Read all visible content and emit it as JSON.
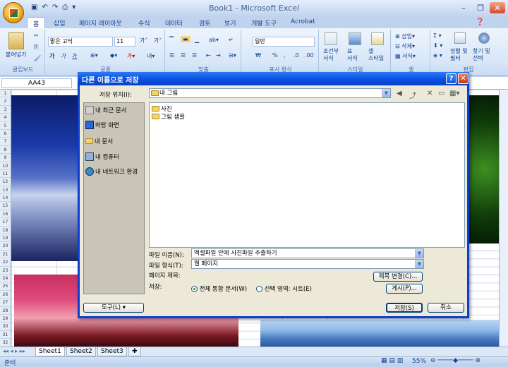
{
  "window": {
    "title": "Book1 - Microsoft Excel"
  },
  "qat": {
    "undo": "↶",
    "redo": "↷"
  },
  "tabs": [
    "홈",
    "삽입",
    "페이지 레이아웃",
    "수식",
    "데이터",
    "검토",
    "보기",
    "개발 도구",
    "Acrobat"
  ],
  "ribbon": {
    "clipboard": {
      "paste": "붙여넣기",
      "label": "클립보드"
    },
    "font": {
      "name": "맑은 고딕",
      "size": "11",
      "bold": "가",
      "italic": "가",
      "underline": "가",
      "label": "글꼴"
    },
    "alignment": {
      "label": "맞춤"
    },
    "number": {
      "format": "일반",
      "currency": "₩",
      "percent": "%",
      "comma": ",",
      "label": "표시 형식"
    },
    "styles": {
      "conditional": "조건부\n서식",
      "table": "표\n서식",
      "cell": "셀\n스타일",
      "label": "스타일"
    },
    "cells": {
      "insert": "삽입",
      "delete": "삭제",
      "format": "서식",
      "label": "셀"
    },
    "editing": {
      "sort": "정렬 및\n필터",
      "find": "찾기 및\n선택",
      "label": "편집"
    }
  },
  "formula_bar": {
    "name_box": "AA43"
  },
  "row_numbers": [
    "1",
    "2",
    "3",
    "4",
    "5",
    "6",
    "7",
    "8",
    "9",
    "10",
    "11",
    "12",
    "13",
    "14",
    "15",
    "16",
    "17",
    "18",
    "19",
    "20",
    "21",
    "22",
    "23",
    "24",
    "25",
    "26",
    "27",
    "28",
    "29",
    "30",
    "31",
    "32"
  ],
  "sheets": [
    "Sheet1",
    "Sheet2",
    "Sheet3"
  ],
  "status": {
    "ready": "준비",
    "zoom": "55%"
  },
  "dialog": {
    "title": "다른 이름으로 저장",
    "save_in_label": "저장 위치(I):",
    "save_in_value": "내 그림",
    "places": [
      "내 최근 문서",
      "바탕 화면",
      "내 문서",
      "내 컴퓨터",
      "내 네트워크 환경"
    ],
    "files": [
      "사진",
      "그림 샘플"
    ],
    "filename_label": "파일 이름(N):",
    "filename_value": "엑셀파일 안에 사진파일 추출하기",
    "filetype_label": "파일 형식(T):",
    "filetype_value": "웹 페이지",
    "page_title_label": "페이지 제목:",
    "change_title_button": "제목 변경(C)...",
    "save_label": "저장:",
    "radio_entire": "전체 통합 문서(W)",
    "radio_selection": "선택 영역: 시트(E)",
    "publish_button": "게시(P)...",
    "tools_button": "도구(L)",
    "save_button": "저장(S)",
    "cancel_button": "취소"
  }
}
